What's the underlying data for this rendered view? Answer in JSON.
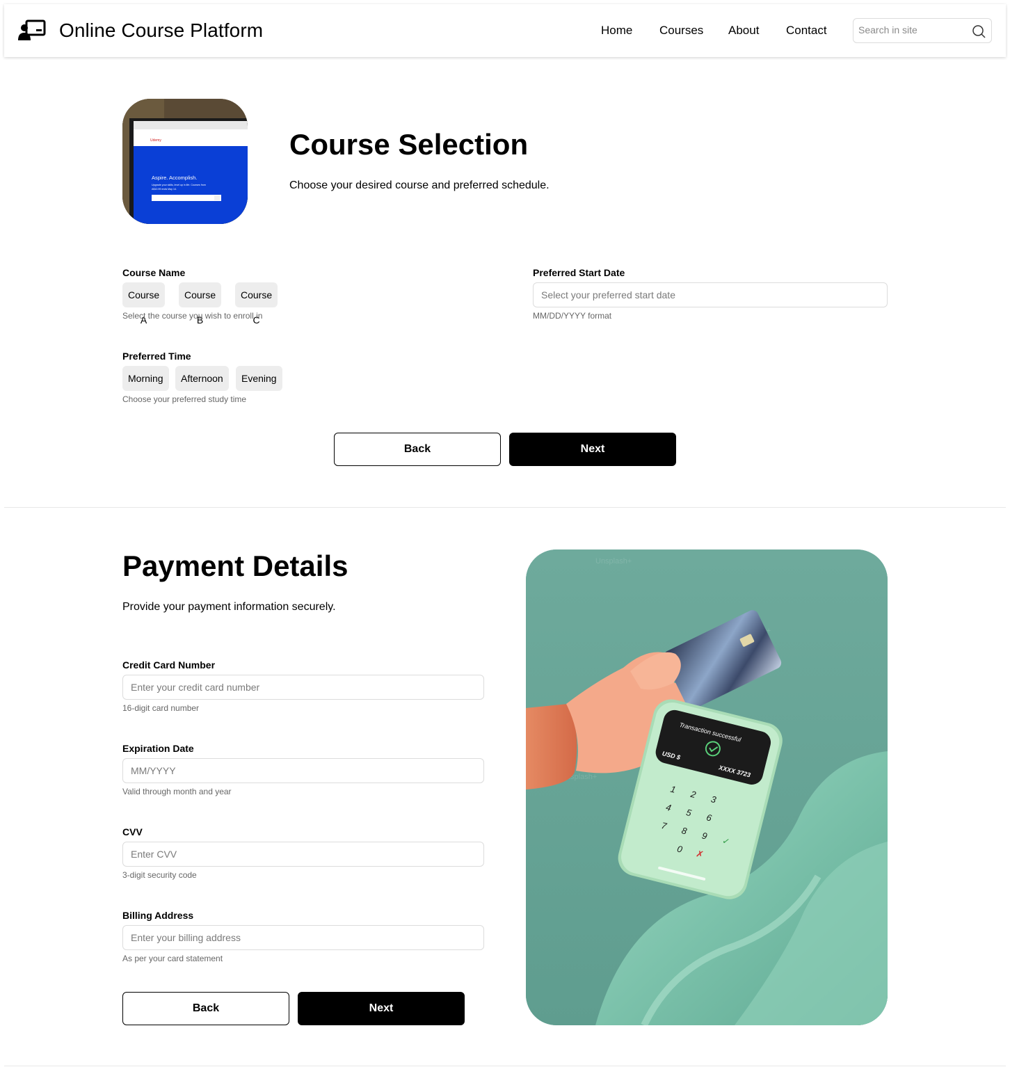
{
  "header": {
    "title": "Online Course Platform",
    "nav": [
      "Home",
      "Courses",
      "About",
      "Contact"
    ],
    "search_placeholder": "Search in site"
  },
  "course_selection": {
    "thumbnail": {
      "headline": "Aspire. Accomplish.",
      "subtext": "Upgrade your skills, level up in life. Courses from",
      "subtext2": "A$10.99 ends May 14.",
      "brand": "Udemy"
    },
    "title": "Course Selection",
    "description": "Choose your desired course and preferred schedule.",
    "course_name": {
      "label": "Course Name",
      "options": [
        "Course A",
        "Course B",
        "Course C"
      ],
      "hint": "Select the course you wish to enroll in"
    },
    "start_date": {
      "label": "Preferred Start Date",
      "placeholder": "Select your preferred start date",
      "hint": "MM/DD/YYYY format"
    },
    "preferred_time": {
      "label": "Preferred Time",
      "options": [
        "Morning",
        "Afternoon",
        "Evening"
      ],
      "hint": "Choose your preferred study time"
    },
    "back_label": "Back",
    "next_label": "Next"
  },
  "payment": {
    "title": "Payment Details",
    "description": "Provide your payment information securely.",
    "card_number": {
      "label": "Credit Card Number",
      "placeholder": "Enter your credit card number",
      "hint": "16-digit card number"
    },
    "expiration": {
      "label": "Expiration Date",
      "placeholder": "MM/YYYY",
      "hint": "Valid through month and year"
    },
    "cvv": {
      "label": "CVV",
      "placeholder": "Enter CVV",
      "hint": "3-digit security code"
    },
    "billing": {
      "label": "Billing Address",
      "placeholder": "Enter your billing address",
      "hint": "As per your card statement"
    },
    "back_label": "Back",
    "next_label": "Next",
    "image": {
      "terminal_status": "Transaction successful",
      "currency": "USD $",
      "card_mask": "XXXX 3723",
      "keypad": [
        "1",
        "2",
        "3",
        "4",
        "5",
        "6",
        "7",
        "8",
        "9",
        "0"
      ],
      "watermark": "Unsplash+",
      "background_color": "#6aa89a",
      "terminal_color": "#b9e6c4"
    }
  }
}
